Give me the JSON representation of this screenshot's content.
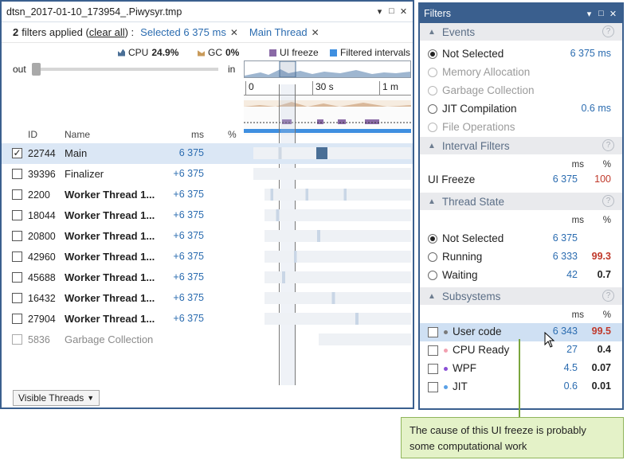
{
  "left_window": {
    "title": "dtsn_2017-01-10_173954_.Piwysyr.tmp",
    "controls": [
      "▾",
      "□",
      "✕"
    ],
    "filter_bar": {
      "count": "2",
      "text": "filters applied",
      "clear_link": "clear all",
      "chips": [
        {
          "label": "Selected 6 375 ms"
        },
        {
          "label": "Main Thread"
        }
      ]
    },
    "stats": {
      "cpu_label": "CPU",
      "cpu_value": "24.9%",
      "gc_label": "GC",
      "gc_value": "0%",
      "ui_freeze_label": "UI freeze",
      "filtered_intervals_label": "Filtered intervals"
    },
    "zoom": {
      "out_label": "out",
      "in_label": "in",
      "level": 0.0
    },
    "ruler": {
      "ticks": [
        "0",
        "30 s",
        "1 m"
      ]
    },
    "table": {
      "headers": {
        "id": "ID",
        "name": "Name",
        "ms": "ms",
        "pct": "%"
      },
      "rows": [
        {
          "id": "22744",
          "name": "Main",
          "ms": "6 375",
          "checked": true,
          "selected": true,
          "bold": false,
          "dim": false
        },
        {
          "id": "39396",
          "name": "Finalizer",
          "ms": "+6 375",
          "checked": false,
          "selected": false,
          "bold": false,
          "dim": false
        },
        {
          "id": "2200",
          "name": "Worker Thread 1...",
          "ms": "+6 375",
          "checked": false,
          "selected": false,
          "bold": true,
          "dim": false
        },
        {
          "id": "18044",
          "name": "Worker Thread 1...",
          "ms": "+6 375",
          "checked": false,
          "selected": false,
          "bold": true,
          "dim": false
        },
        {
          "id": "20800",
          "name": "Worker Thread 1...",
          "ms": "+6 375",
          "checked": false,
          "selected": false,
          "bold": true,
          "dim": false
        },
        {
          "id": "42960",
          "name": "Worker Thread 1...",
          "ms": "+6 375",
          "checked": false,
          "selected": false,
          "bold": true,
          "dim": false
        },
        {
          "id": "45688",
          "name": "Worker Thread 1...",
          "ms": "+6 375",
          "checked": false,
          "selected": false,
          "bold": true,
          "dim": false
        },
        {
          "id": "16432",
          "name": "Worker Thread 1...",
          "ms": "+6 375",
          "checked": false,
          "selected": false,
          "bold": true,
          "dim": false
        },
        {
          "id": "27904",
          "name": "Worker Thread 1...",
          "ms": "+6 375",
          "checked": false,
          "selected": false,
          "bold": true,
          "dim": false
        },
        {
          "id": "5836",
          "name": "Garbage Collection",
          "ms": "",
          "checked": false,
          "selected": false,
          "bold": false,
          "dim": true
        }
      ]
    },
    "visible_threads_button": "Visible Threads"
  },
  "right_window": {
    "title": "Filters",
    "controls": [
      "▾",
      "□",
      "✕"
    ],
    "events": {
      "header": "Events",
      "items": [
        {
          "label": "Not Selected",
          "value": "6 375 ms",
          "selected": true,
          "enabled": true
        },
        {
          "label": "Memory Allocation",
          "value": "",
          "selected": false,
          "enabled": false
        },
        {
          "label": "Garbage Collection",
          "value": "",
          "selected": false,
          "enabled": false
        },
        {
          "label": "JIT Compilation",
          "value": "0.6 ms",
          "selected": false,
          "enabled": true
        },
        {
          "label": "File Operations",
          "value": "",
          "selected": false,
          "enabled": false
        }
      ]
    },
    "interval_filters": {
      "header": "Interval Filters",
      "col_ms": "ms",
      "col_pct": "%",
      "items": [
        {
          "label": "UI Freeze",
          "ms": "6 375",
          "pct": "100"
        }
      ]
    },
    "thread_state": {
      "header": "Thread State",
      "col_ms": "ms",
      "col_pct": "%",
      "items": [
        {
          "label": "Not Selected",
          "ms": "6 375",
          "pct": "",
          "selected": true
        },
        {
          "label": "Running",
          "ms": "6 333",
          "pct": "99.3",
          "selected": false
        },
        {
          "label": "Waiting",
          "ms": "42",
          "pct": "0.7",
          "selected": false
        }
      ]
    },
    "subsystems": {
      "header": "Subsystems",
      "col_ms": "ms",
      "col_pct": "%",
      "items": [
        {
          "label": "User code",
          "ms": "6 343",
          "pct": "99.5",
          "dot": "#7a7a7a",
          "selected": true
        },
        {
          "label": "CPU Ready",
          "ms": "27",
          "pct": "0.4",
          "dot": "#f2a0b0",
          "selected": false
        },
        {
          "label": "WPF",
          "ms": "4.5",
          "pct": "0.07",
          "dot": "#8a4fd6",
          "selected": false
        },
        {
          "label": "JIT",
          "ms": "0.6",
          "pct": "0.01",
          "dot": "#5aa0e6",
          "selected": false
        }
      ]
    }
  },
  "callout": {
    "text_line1": "The cause of this UI freeze is probably",
    "text_line2": "some computational work"
  },
  "colors": {
    "accent": "#3a5f8e",
    "link_blue": "#2b6cb0",
    "cpu": "#4a6f96",
    "gc": "#c89a5a",
    "ui_freeze": "#8a6aa6",
    "filtered_intervals": "#3f8fe0",
    "red_value": "#c0392b",
    "callout_bg": "#e4f2c8"
  }
}
